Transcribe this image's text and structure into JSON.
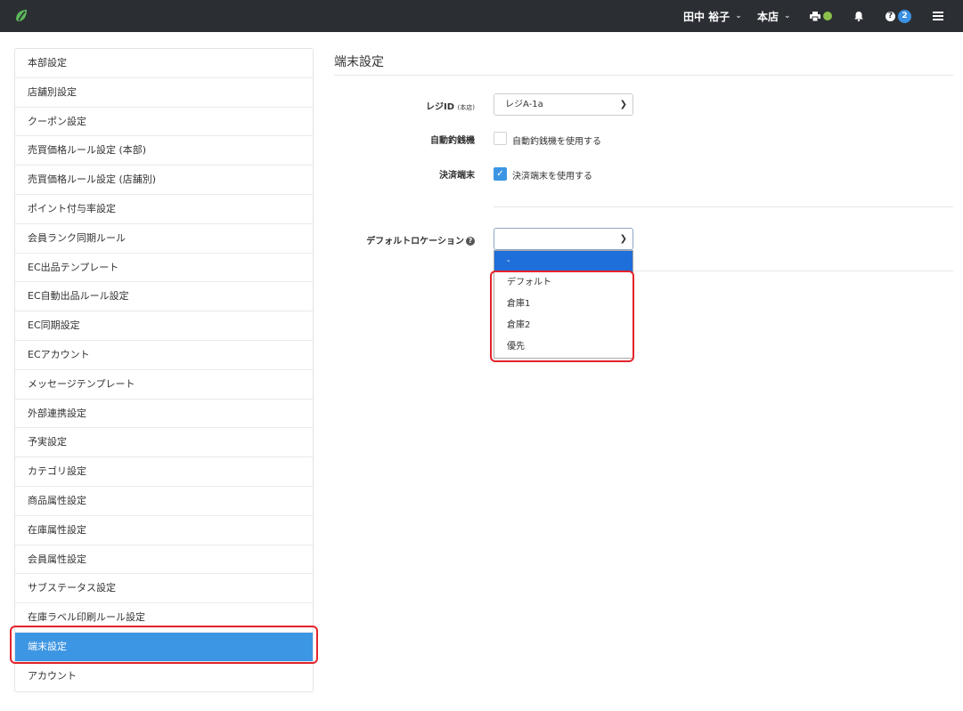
{
  "topbar": {
    "logo_icon": "leaf-logo",
    "user_name": "田中 裕子",
    "store_name": "本店",
    "help_badge_count": "2",
    "status_color": "#8bc34a",
    "accent_color": "#3d96e3"
  },
  "sidebar": {
    "items": [
      {
        "label": "本部設定"
      },
      {
        "label": "店舗別設定"
      },
      {
        "label": "クーポン設定"
      },
      {
        "label": "売買価格ルール設定 (本部)"
      },
      {
        "label": "売買価格ルール設定 (店舗別)"
      },
      {
        "label": "ポイント付与率設定"
      },
      {
        "label": "会員ランク同期ルール"
      },
      {
        "label": "EC出品テンプレート"
      },
      {
        "label": "EC自動出品ルール設定"
      },
      {
        "label": "EC同期設定"
      },
      {
        "label": "ECアカウント"
      },
      {
        "label": "メッセージテンプレート"
      },
      {
        "label": "外部連携設定"
      },
      {
        "label": "予実設定"
      },
      {
        "label": "カテゴリ設定"
      },
      {
        "label": "商品属性設定"
      },
      {
        "label": "在庫属性設定"
      },
      {
        "label": "会員属性設定"
      },
      {
        "label": "サブステータス設定"
      },
      {
        "label": "在庫ラベル印刷ルール設定"
      },
      {
        "label": "端末設定",
        "active": true
      },
      {
        "label": "アカウント"
      }
    ]
  },
  "main": {
    "title": "端末設定",
    "regi_label": "レジID",
    "regi_sub": "(本店)",
    "regi_value": "レジA-1a",
    "auto_changer_label": "自動釣銭機",
    "auto_changer_checkbox": "自動釣銭機を使用する",
    "auto_changer_checked": false,
    "payment_label": "決済端末",
    "payment_checkbox": "決済端末を使用する",
    "payment_checked": true,
    "location_label": "デフォルトロケーション",
    "location_value": "",
    "location_options": [
      "-",
      "デフォルト",
      "倉庫1",
      "倉庫2",
      "優先"
    ],
    "location_selected": "-"
  }
}
